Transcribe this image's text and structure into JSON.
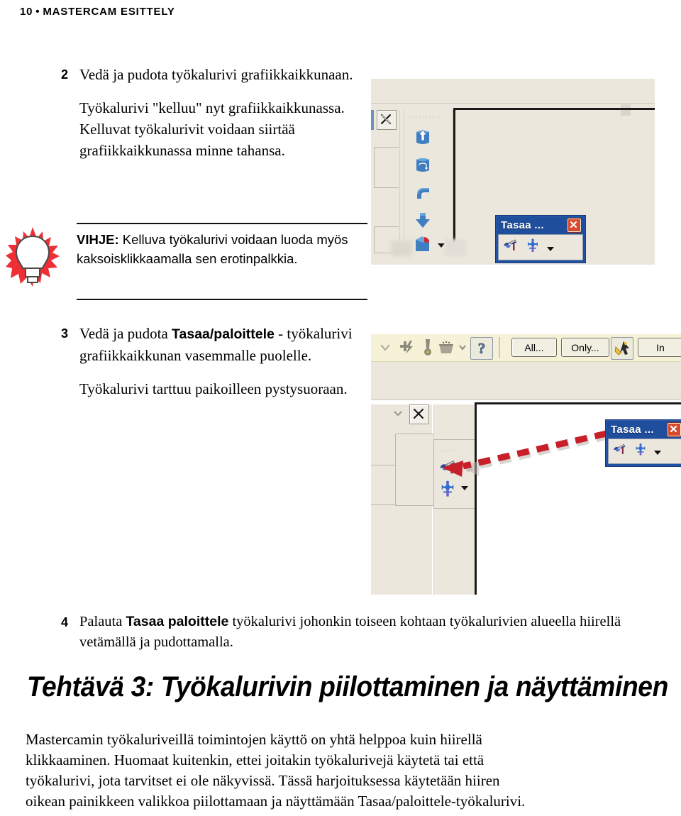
{
  "header": {
    "page_number": "10",
    "separator": "•",
    "title": "MASTERCAM ESITTELY"
  },
  "steps": [
    {
      "number": "2",
      "lead": "Vedä ja pudota työkalurivi grafiikkaikkunaan.",
      "detail": "Työkalurivi \"kelluu\" nyt grafiikkaikkunassa. Kelluvat työkalurivit voidaan siirtää grafiikkaikkunassa minne tahansa."
    }
  ],
  "tip": {
    "label": "VIHJE:",
    "text": "Kelluva työkalurivi voidaan luoda myös kaksoisklikkaamalla sen erotinpalkkia.",
    "icon": "lightbulb-icon",
    "icon_color": "#ee2f36"
  },
  "step3": {
    "number": "3",
    "lead_pre": "Vedä ja pudota ",
    "lead_bold": "Tasaa/paloittele",
    "lead_post": " - työkalurivi grafiikkaikkunan vasemmalle puolelle.",
    "detail": "Työkalurivi tarttuu paikoilleen pystysuoraan."
  },
  "step4": {
    "number": "4",
    "pre": "Palauta ",
    "bold": "Tasaa paloittele",
    "post": " työkalurivi johonkin toiseen kohtaan työkalurivien alueella hiirellä vetämällä ja pudottamalla."
  },
  "section_title": "Tehtävä 3: Työkalurivin piilottaminen ja näyttäminen",
  "closing": {
    "line1": "Mastercamin työkaluriveillä toimintojen käyttö on yhtä helppoa kuin hiirellä",
    "line2": "klikkaaminen. Huomaat kuitenkin, ettei joitakin työkalurivejä käytetä tai että",
    "line3": "työkalurivi, jota tarvitset ei ole näkyvissä.  Tässä harjoituksessa käytetään hiiren",
    "line4": "oikean painikkeen valikkoa piilottamaan ja näyttämään Tasaa/paloittele-työkalurivi."
  },
  "figure1": {
    "name": "floating-toolbar-screenshot",
    "floating_toolbar": {
      "title": "Tasaa ...",
      "close_label": "x",
      "buttons": [
        "align-tool-icon",
        "break-tool-icon"
      ],
      "dropdown": "caret-down-icon",
      "title_bg": "#1f4e9c",
      "close_bg": "#d94a2b"
    },
    "docked_toolbar_icons": [
      "extrude-up-icon",
      "revolve-icon",
      "sweep-icon",
      "loft-down-icon",
      "boolean-icon"
    ],
    "close_button": "toolbar-close-x-icon",
    "grip_dots": "···········"
  },
  "figure2": {
    "name": "docked-toolbar-screenshot",
    "toolbar_buttons": [
      {
        "name": "chevron-down-icon",
        "label": ""
      },
      {
        "name": "add-lightning-icon",
        "label": ""
      },
      {
        "name": "warning-medal-icon",
        "label": ""
      },
      {
        "name": "bucket-icon",
        "label": ""
      },
      {
        "name": "bucket-dropdown-icon",
        "label": ""
      },
      {
        "name": "help-question-icon",
        "label": ""
      }
    ],
    "text_buttons": [
      {
        "name": "all-button",
        "label": "All..."
      },
      {
        "name": "only-button",
        "label": "Only..."
      },
      {
        "name": "in-button",
        "label": "In"
      }
    ],
    "cursor_button": "select-cursor-icon",
    "floating_toolbar": {
      "title": "Tasaa ...",
      "buttons": [
        "align-tool-icon",
        "break-tool-icon"
      ],
      "dropdown": "caret-down-icon"
    },
    "docked_toolbar_icons": [
      "align-tool-icon",
      "break-tool-icon"
    ],
    "close_button": "toolbar-close-x-icon",
    "grip_dots": "·······",
    "annotation_arrow": {
      "name": "drag-direction-arrow",
      "color": "#c8202b",
      "style": "dashed"
    }
  }
}
